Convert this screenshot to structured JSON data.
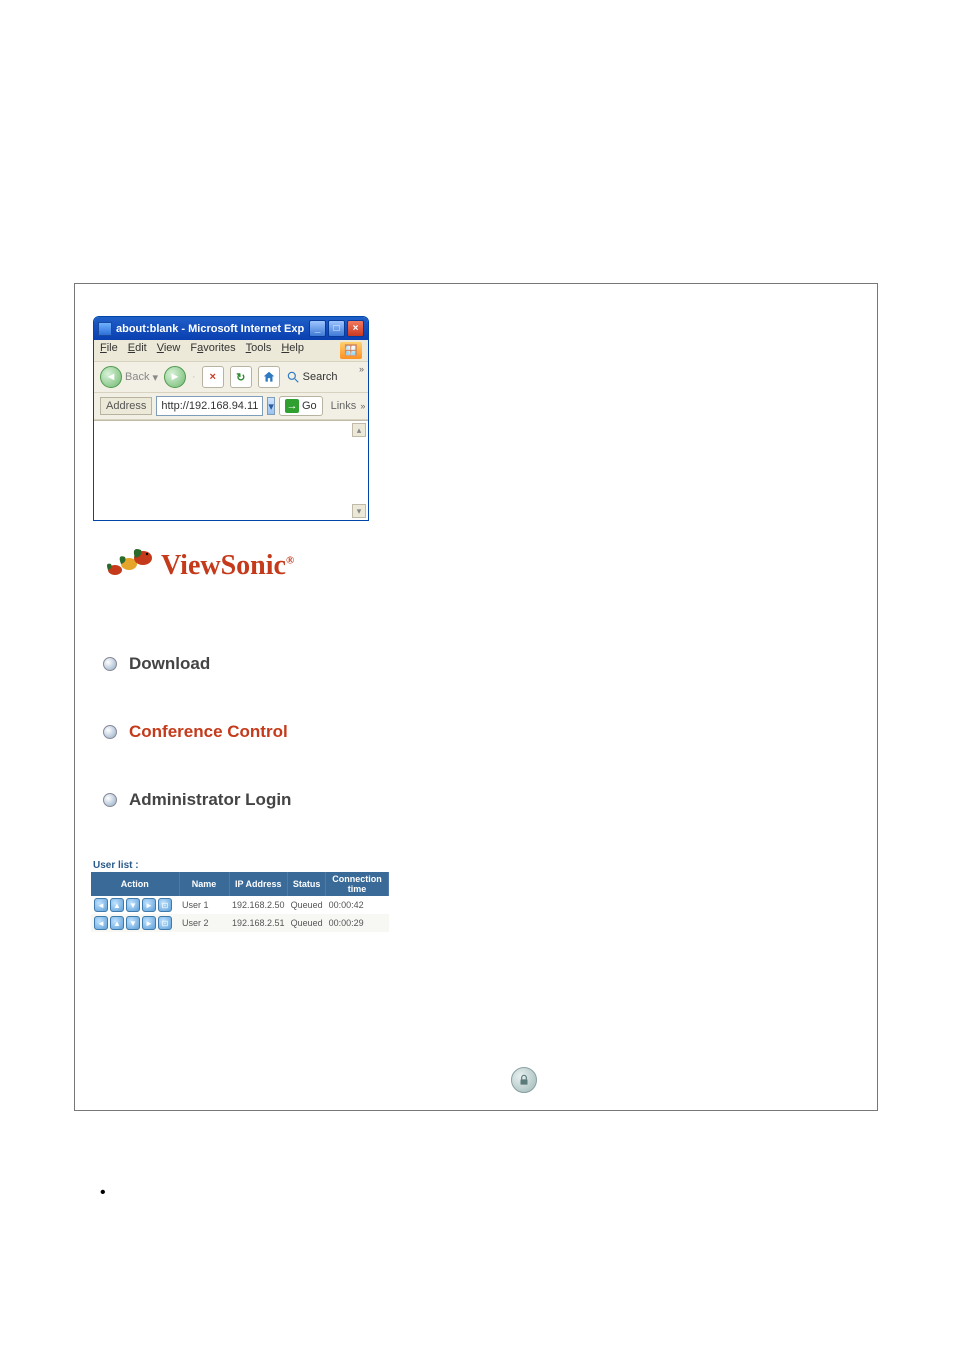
{
  "window": {
    "title": "about:blank - Microsoft Internet Explorer",
    "menu": [
      "File",
      "Edit",
      "View",
      "Favorites",
      "Tools",
      "Help"
    ],
    "menu_underline": [
      "F",
      "E",
      "V",
      "a",
      "T",
      "H"
    ],
    "back_label": "Back",
    "search_label": "Search",
    "address_label": "Address",
    "address_value": "http://192.168.94.11",
    "go_label": "Go",
    "links_label": "Links",
    "more_glyph": "»"
  },
  "brand": {
    "name": "ViewSonic",
    "reg": "®"
  },
  "nav": {
    "items": [
      {
        "label": "Download",
        "active": false
      },
      {
        "label": "Conference Control",
        "active": true
      },
      {
        "label": "Administrator Login",
        "active": false
      }
    ]
  },
  "userlist": {
    "title": "User list :",
    "headers": [
      "Action",
      "Name",
      "IP Address",
      "Status",
      "Connection time"
    ],
    "rows": [
      {
        "name": "User 1",
        "ip": "192.168.2.50",
        "status": "Queued",
        "time": "00:00:42"
      },
      {
        "name": "User 2",
        "ip": "192.168.2.51",
        "status": "Queued",
        "time": "00:00:29"
      }
    ]
  },
  "arrow_glyphs": [
    "◄",
    "▲",
    "▼",
    "►",
    "⊡"
  ]
}
